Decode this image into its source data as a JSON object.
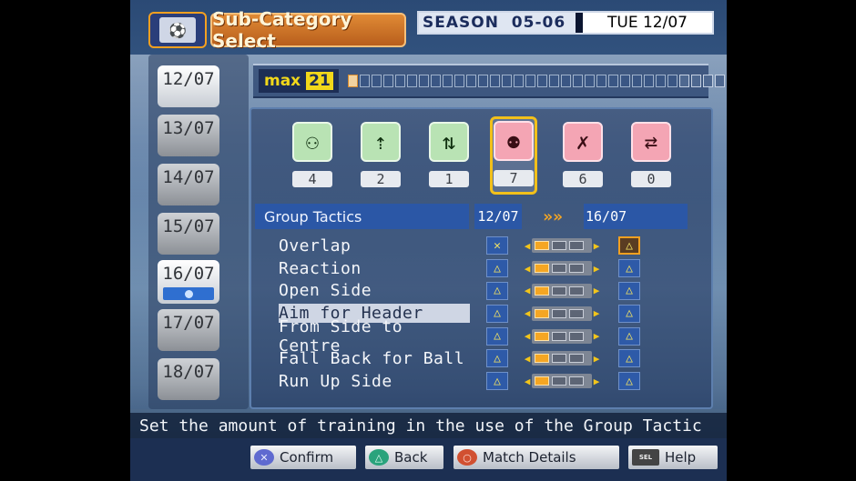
{
  "header": {
    "category_icon": "training-field-icon",
    "subcategory_title": "Sub-Category Select",
    "season_label": "SEASON",
    "season_value": "05-06",
    "date": "TUE 12/07"
  },
  "date_list": [
    {
      "label": "12/07"
    },
    {
      "label": "13/07"
    },
    {
      "label": "14/07"
    },
    {
      "label": "15/07"
    },
    {
      "label": "16/07"
    },
    {
      "label": "17/07"
    },
    {
      "label": "18/07"
    }
  ],
  "max_bar": {
    "label": "max",
    "value": "21"
  },
  "categories": [
    {
      "icon": "formation-icon",
      "count": "4"
    },
    {
      "icon": "formation-up-icon",
      "count": "2"
    },
    {
      "icon": "formation-split-icon",
      "count": "1"
    },
    {
      "icon": "group-tactics-icon",
      "count": "7"
    },
    {
      "icon": "individual-run-icon",
      "count": "6"
    },
    {
      "icon": "set-play-icon",
      "count": "0"
    }
  ],
  "tactics": {
    "title": "Group Tactics",
    "date_from": "12/07",
    "arrows": "»»",
    "date_to": "16/07",
    "rows": [
      {
        "name": "Overlap",
        "current": "✕",
        "new": "△"
      },
      {
        "name": "Reaction",
        "current": "△",
        "new": "△"
      },
      {
        "name": "Open Side",
        "current": "△",
        "new": "△"
      },
      {
        "name": "Aim for Header",
        "current": "△",
        "new": "△"
      },
      {
        "name": "From Side to Centre",
        "current": "△",
        "new": "△"
      },
      {
        "name": "Fall Back for Ball",
        "current": "△",
        "new": "△"
      },
      {
        "name": "Run Up Side",
        "current": "△",
        "new": "△"
      }
    ]
  },
  "instruction": "Set the amount of training in the use of the Group Tactic",
  "footer": {
    "confirm": "Confirm",
    "back": "Back",
    "match_details": "Match Details",
    "help": "Help"
  },
  "colors": {
    "accent_orange": "#e08a35",
    "highlight_yellow": "#f2c01a",
    "panel_blue": "#2b57a6"
  }
}
